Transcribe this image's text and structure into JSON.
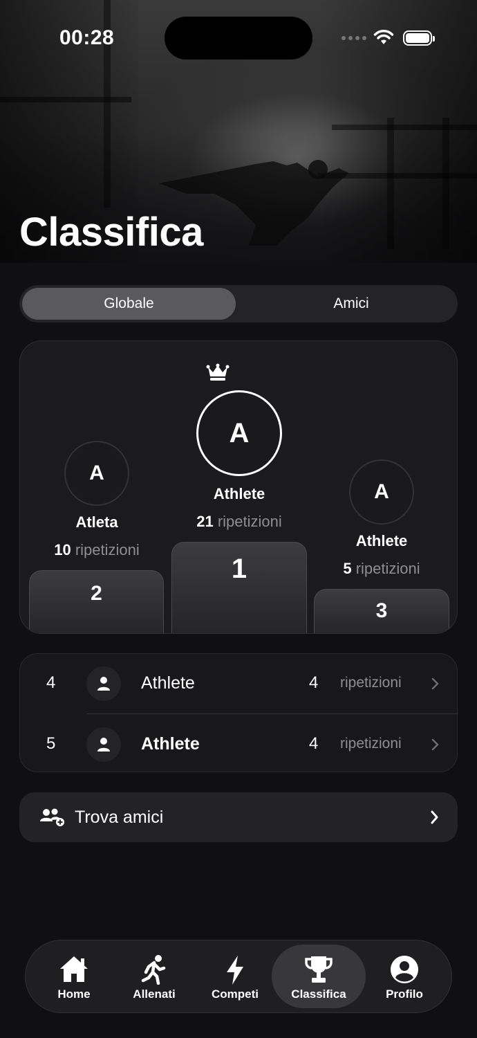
{
  "status_bar": {
    "time": "00:28"
  },
  "page_title": "Classifica",
  "segments": {
    "global": "Globale",
    "friends": "Amici"
  },
  "podium": {
    "first": {
      "initial": "A",
      "name": "Athlete",
      "count": "21",
      "unit": "ripetizioni",
      "rank": "1"
    },
    "second": {
      "initial": "A",
      "name": "Atleta",
      "count": "10",
      "unit": "ripetizioni",
      "rank": "2"
    },
    "third": {
      "initial": "A",
      "name": "Athlete",
      "count": "5",
      "unit": "ripetizioni",
      "rank": "3"
    }
  },
  "rankings": [
    {
      "position": "4",
      "name": "Athlete",
      "count": "4",
      "unit": "ripetizioni"
    },
    {
      "position": "5",
      "name": "Athlete",
      "count": "4",
      "unit": "ripetizioni"
    }
  ],
  "find_friends": {
    "label": "Trova amici"
  },
  "tabbar": {
    "active": "Classifica",
    "items": [
      {
        "label": "Home",
        "icon": "house-icon"
      },
      {
        "label": "Allenati",
        "icon": "running-icon"
      },
      {
        "label": "Competi",
        "icon": "bolt-icon"
      },
      {
        "label": "Classifica",
        "icon": "trophy-icon"
      },
      {
        "label": "Profilo",
        "icon": "profile-icon"
      }
    ]
  }
}
